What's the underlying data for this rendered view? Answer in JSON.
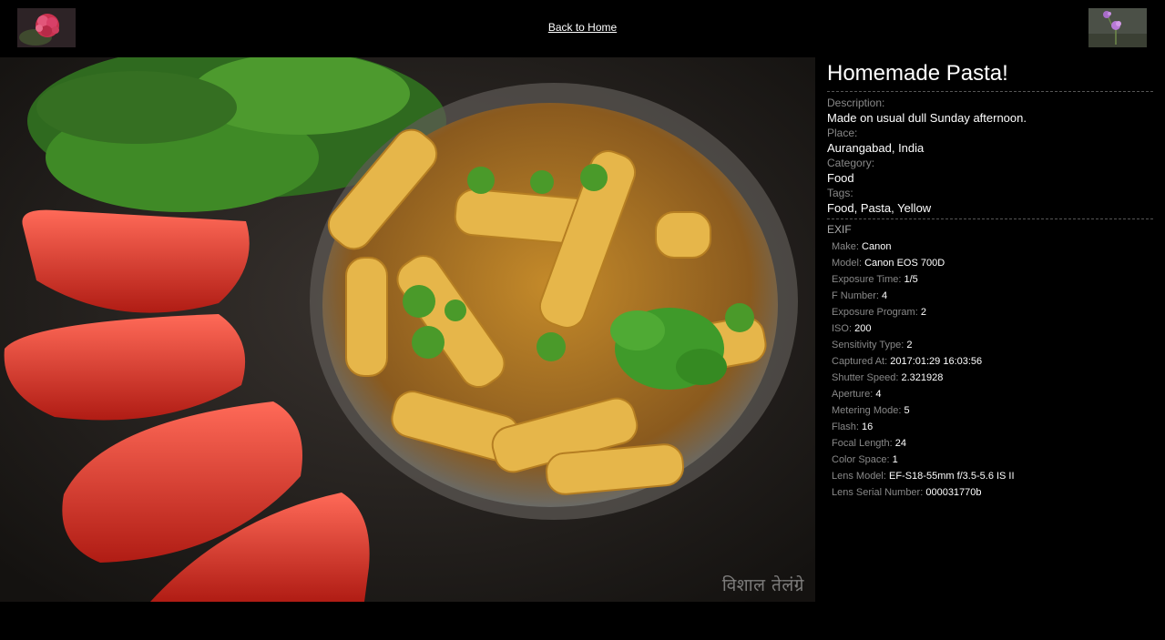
{
  "nav": {
    "home_label": "Back to Home",
    "prev_thumb_icon": "flower-thumbnail-icon",
    "next_thumb_icon": "flower-thumbnail-icon"
  },
  "photo": {
    "subject_icon": "pasta-photo",
    "watermark": "विशाल तेलंग्रे"
  },
  "info": {
    "title": "Homemade Pasta!",
    "description_label": "Description:",
    "description": "Made on usual dull Sunday afternoon.",
    "place_label": "Place:",
    "place": "Aurangabad, India",
    "category_label": "Category:",
    "category": "Food",
    "tags_label": "Tags:",
    "tags": "Food, Pasta, Yellow"
  },
  "exif": {
    "heading": "EXIF",
    "items": [
      {
        "key": "Make:",
        "value": "Canon"
      },
      {
        "key": "Model:",
        "value": "Canon EOS 700D"
      },
      {
        "key": "Exposure Time:",
        "value": "1/5"
      },
      {
        "key": "F Number:",
        "value": "4"
      },
      {
        "key": "Exposure Program:",
        "value": "2"
      },
      {
        "key": "ISO:",
        "value": "200"
      },
      {
        "key": "Sensitivity Type:",
        "value": "2"
      },
      {
        "key": "Captured At:",
        "value": "2017:01:29 16:03:56"
      },
      {
        "key": "Shutter Speed:",
        "value": "2.321928"
      },
      {
        "key": "Aperture:",
        "value": "4"
      },
      {
        "key": "Metering Mode:",
        "value": "5"
      },
      {
        "key": "Flash:",
        "value": "16"
      },
      {
        "key": "Focal Length:",
        "value": "24"
      },
      {
        "key": "Color Space:",
        "value": "1"
      },
      {
        "key": "Lens Model:",
        "value": "EF-S18-55mm f/3.5-5.6 IS II"
      },
      {
        "key": "Lens Serial Number:",
        "value": "000031770b"
      }
    ]
  },
  "colors": {
    "background": "#000000",
    "label": "#888888",
    "text": "#ffffff"
  }
}
